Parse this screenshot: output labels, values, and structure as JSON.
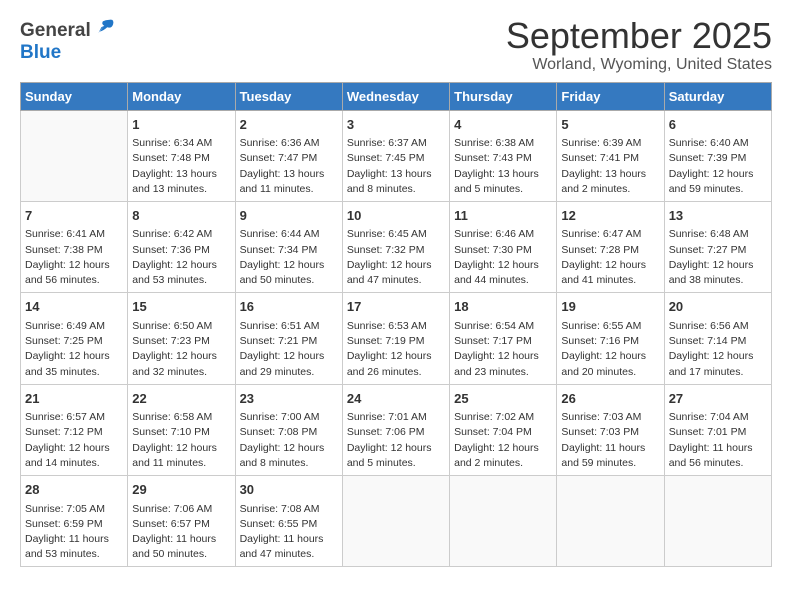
{
  "header": {
    "logo_general": "General",
    "logo_blue": "Blue",
    "month_title": "September 2025",
    "subtitle": "Worland, Wyoming, United States"
  },
  "days_of_week": [
    "Sunday",
    "Monday",
    "Tuesday",
    "Wednesday",
    "Thursday",
    "Friday",
    "Saturday"
  ],
  "weeks": [
    [
      {
        "day": "",
        "sunrise": "",
        "sunset": "",
        "daylight": ""
      },
      {
        "day": "1",
        "sunrise": "Sunrise: 6:34 AM",
        "sunset": "Sunset: 7:48 PM",
        "daylight": "Daylight: 13 hours and 13 minutes."
      },
      {
        "day": "2",
        "sunrise": "Sunrise: 6:36 AM",
        "sunset": "Sunset: 7:47 PM",
        "daylight": "Daylight: 13 hours and 11 minutes."
      },
      {
        "day": "3",
        "sunrise": "Sunrise: 6:37 AM",
        "sunset": "Sunset: 7:45 PM",
        "daylight": "Daylight: 13 hours and 8 minutes."
      },
      {
        "day": "4",
        "sunrise": "Sunrise: 6:38 AM",
        "sunset": "Sunset: 7:43 PM",
        "daylight": "Daylight: 13 hours and 5 minutes."
      },
      {
        "day": "5",
        "sunrise": "Sunrise: 6:39 AM",
        "sunset": "Sunset: 7:41 PM",
        "daylight": "Daylight: 13 hours and 2 minutes."
      },
      {
        "day": "6",
        "sunrise": "Sunrise: 6:40 AM",
        "sunset": "Sunset: 7:39 PM",
        "daylight": "Daylight: 12 hours and 59 minutes."
      }
    ],
    [
      {
        "day": "7",
        "sunrise": "Sunrise: 6:41 AM",
        "sunset": "Sunset: 7:38 PM",
        "daylight": "Daylight: 12 hours and 56 minutes."
      },
      {
        "day": "8",
        "sunrise": "Sunrise: 6:42 AM",
        "sunset": "Sunset: 7:36 PM",
        "daylight": "Daylight: 12 hours and 53 minutes."
      },
      {
        "day": "9",
        "sunrise": "Sunrise: 6:44 AM",
        "sunset": "Sunset: 7:34 PM",
        "daylight": "Daylight: 12 hours and 50 minutes."
      },
      {
        "day": "10",
        "sunrise": "Sunrise: 6:45 AM",
        "sunset": "Sunset: 7:32 PM",
        "daylight": "Daylight: 12 hours and 47 minutes."
      },
      {
        "day": "11",
        "sunrise": "Sunrise: 6:46 AM",
        "sunset": "Sunset: 7:30 PM",
        "daylight": "Daylight: 12 hours and 44 minutes."
      },
      {
        "day": "12",
        "sunrise": "Sunrise: 6:47 AM",
        "sunset": "Sunset: 7:28 PM",
        "daylight": "Daylight: 12 hours and 41 minutes."
      },
      {
        "day": "13",
        "sunrise": "Sunrise: 6:48 AM",
        "sunset": "Sunset: 7:27 PM",
        "daylight": "Daylight: 12 hours and 38 minutes."
      }
    ],
    [
      {
        "day": "14",
        "sunrise": "Sunrise: 6:49 AM",
        "sunset": "Sunset: 7:25 PM",
        "daylight": "Daylight: 12 hours and 35 minutes."
      },
      {
        "day": "15",
        "sunrise": "Sunrise: 6:50 AM",
        "sunset": "Sunset: 7:23 PM",
        "daylight": "Daylight: 12 hours and 32 minutes."
      },
      {
        "day": "16",
        "sunrise": "Sunrise: 6:51 AM",
        "sunset": "Sunset: 7:21 PM",
        "daylight": "Daylight: 12 hours and 29 minutes."
      },
      {
        "day": "17",
        "sunrise": "Sunrise: 6:53 AM",
        "sunset": "Sunset: 7:19 PM",
        "daylight": "Daylight: 12 hours and 26 minutes."
      },
      {
        "day": "18",
        "sunrise": "Sunrise: 6:54 AM",
        "sunset": "Sunset: 7:17 PM",
        "daylight": "Daylight: 12 hours and 23 minutes."
      },
      {
        "day": "19",
        "sunrise": "Sunrise: 6:55 AM",
        "sunset": "Sunset: 7:16 PM",
        "daylight": "Daylight: 12 hours and 20 minutes."
      },
      {
        "day": "20",
        "sunrise": "Sunrise: 6:56 AM",
        "sunset": "Sunset: 7:14 PM",
        "daylight": "Daylight: 12 hours and 17 minutes."
      }
    ],
    [
      {
        "day": "21",
        "sunrise": "Sunrise: 6:57 AM",
        "sunset": "Sunset: 7:12 PM",
        "daylight": "Daylight: 12 hours and 14 minutes."
      },
      {
        "day": "22",
        "sunrise": "Sunrise: 6:58 AM",
        "sunset": "Sunset: 7:10 PM",
        "daylight": "Daylight: 12 hours and 11 minutes."
      },
      {
        "day": "23",
        "sunrise": "Sunrise: 7:00 AM",
        "sunset": "Sunset: 7:08 PM",
        "daylight": "Daylight: 12 hours and 8 minutes."
      },
      {
        "day": "24",
        "sunrise": "Sunrise: 7:01 AM",
        "sunset": "Sunset: 7:06 PM",
        "daylight": "Daylight: 12 hours and 5 minutes."
      },
      {
        "day": "25",
        "sunrise": "Sunrise: 7:02 AM",
        "sunset": "Sunset: 7:04 PM",
        "daylight": "Daylight: 12 hours and 2 minutes."
      },
      {
        "day": "26",
        "sunrise": "Sunrise: 7:03 AM",
        "sunset": "Sunset: 7:03 PM",
        "daylight": "Daylight: 11 hours and 59 minutes."
      },
      {
        "day": "27",
        "sunrise": "Sunrise: 7:04 AM",
        "sunset": "Sunset: 7:01 PM",
        "daylight": "Daylight: 11 hours and 56 minutes."
      }
    ],
    [
      {
        "day": "28",
        "sunrise": "Sunrise: 7:05 AM",
        "sunset": "Sunset: 6:59 PM",
        "daylight": "Daylight: 11 hours and 53 minutes."
      },
      {
        "day": "29",
        "sunrise": "Sunrise: 7:06 AM",
        "sunset": "Sunset: 6:57 PM",
        "daylight": "Daylight: 11 hours and 50 minutes."
      },
      {
        "day": "30",
        "sunrise": "Sunrise: 7:08 AM",
        "sunset": "Sunset: 6:55 PM",
        "daylight": "Daylight: 11 hours and 47 minutes."
      },
      {
        "day": "",
        "sunrise": "",
        "sunset": "",
        "daylight": ""
      },
      {
        "day": "",
        "sunrise": "",
        "sunset": "",
        "daylight": ""
      },
      {
        "day": "",
        "sunrise": "",
        "sunset": "",
        "daylight": ""
      },
      {
        "day": "",
        "sunrise": "",
        "sunset": "",
        "daylight": ""
      }
    ]
  ]
}
